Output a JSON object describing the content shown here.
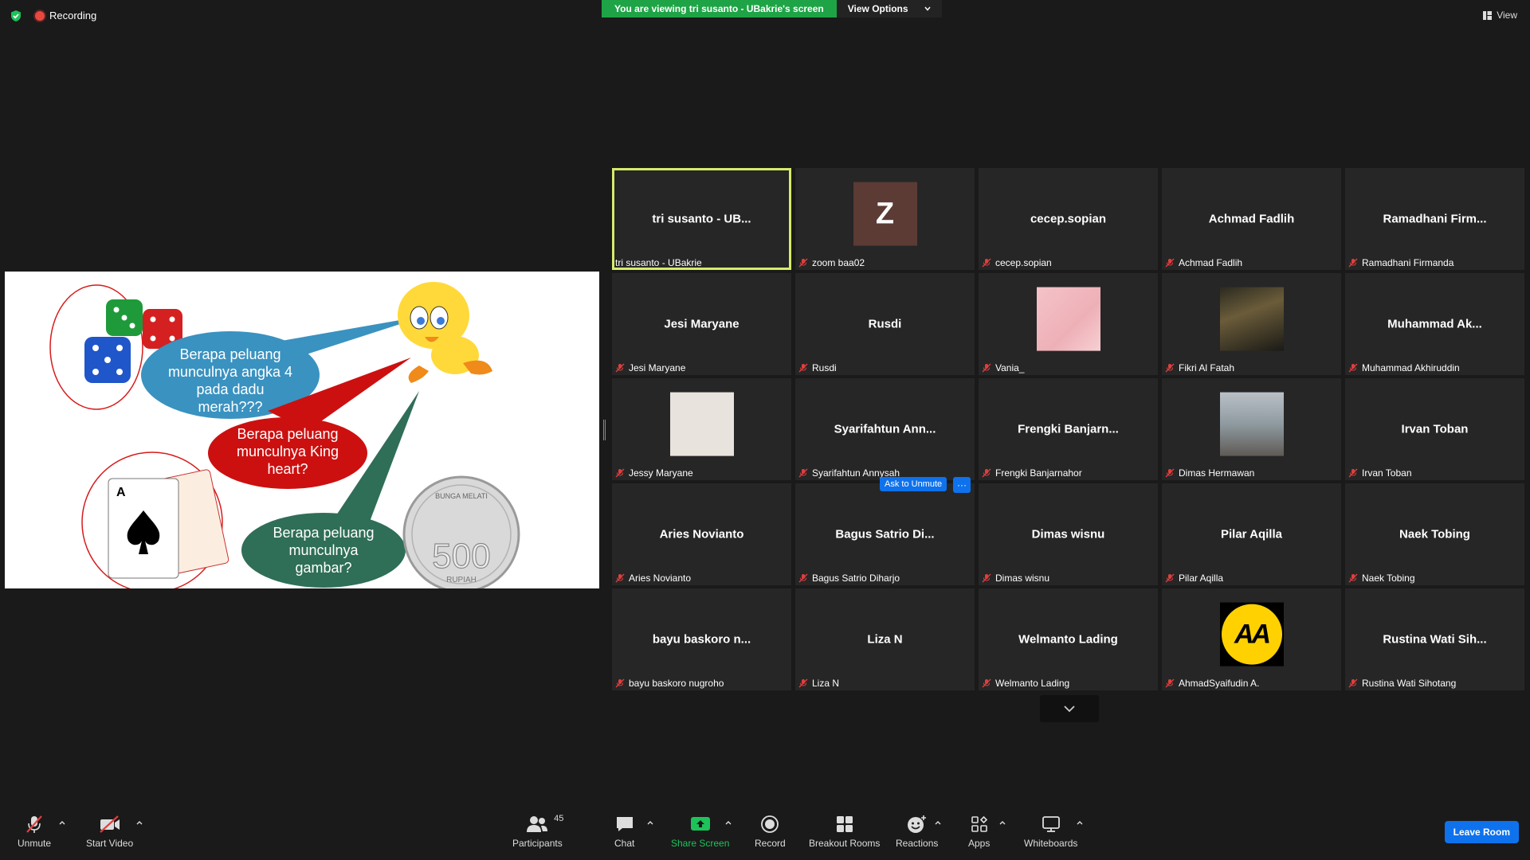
{
  "topbar": {
    "recording": "Recording",
    "banner": "You are viewing tri susanto - UBakrie's screen",
    "view_options": "View Options",
    "view": "View"
  },
  "slide": {
    "q1": [
      "Berapa peluang",
      "munculnya angka 4",
      "pada dadu",
      "merah???"
    ],
    "q2": [
      "Berapa peluang",
      "munculnya  King",
      "heart?"
    ],
    "q3": [
      "Berapa peluang",
      "munculnya",
      "gambar?"
    ],
    "coin_value": "500",
    "coin_top": "BUNGA MELATI",
    "coin_bottom": "RUPIAH",
    "card_letter": "A"
  },
  "tiles": [
    {
      "name": "tri susanto - UB...",
      "label": "tri susanto - UBakrie",
      "muted": false,
      "active": true
    },
    {
      "name": "",
      "label": "zoom baa02",
      "muted": true,
      "avatar": "Z"
    },
    {
      "name": "cecep.sopian",
      "label": "cecep.sopian",
      "muted": true
    },
    {
      "name": "Achmad Fadlih",
      "label": "Achmad Fadlih",
      "muted": true
    },
    {
      "name": "Ramadhani  Firm...",
      "label": "Ramadhani Firmanda",
      "muted": true
    },
    {
      "name": "Jesi Maryane",
      "label": "Jesi Maryane",
      "muted": true
    },
    {
      "name": "Rusdi",
      "label": "Rusdi",
      "muted": true
    },
    {
      "name": "",
      "label": "Vania_",
      "muted": true,
      "avatar": "pink"
    },
    {
      "name": "",
      "label": "Fikri Al Fatah",
      "muted": true,
      "avatar": "photo1"
    },
    {
      "name": "Muhammad  Ak...",
      "label": "Muhammad Akhiruddin",
      "muted": true
    },
    {
      "name": "",
      "label": "Jessy Maryane",
      "muted": true,
      "avatar": "hijab"
    },
    {
      "name": "Syarifahtun  Ann...",
      "label": "Syarifahtun Annysah",
      "muted": true
    },
    {
      "name": "Frengki  Banjarn...",
      "label": "Frengki Banjarnahor",
      "muted": true
    },
    {
      "name": "",
      "label": "Dimas Hermawan",
      "muted": true,
      "avatar": "forest"
    },
    {
      "name": "Irvan Toban",
      "label": "Irvan Toban",
      "muted": true
    },
    {
      "name": "Aries Novianto",
      "label": "Aries Novianto",
      "muted": true
    },
    {
      "name": "Bagus  Satrio  Di...",
      "label": "Bagus Satrio Diharjo",
      "muted": true,
      "ask_unmute": "Ask to Unmute",
      "more": "···"
    },
    {
      "name": "Dimas wisnu",
      "label": "Dimas wisnu",
      "muted": true
    },
    {
      "name": "Pilar Aqilla",
      "label": "Pilar Aqilla",
      "muted": true
    },
    {
      "name": "Naek Tobing",
      "label": "Naek Tobing",
      "muted": true
    },
    {
      "name": "bayu  baskoro  n...",
      "label": "bayu baskoro nugroho",
      "muted": true
    },
    {
      "name": "Liza N",
      "label": "Liza N",
      "muted": true
    },
    {
      "name": "Welmanto Lading",
      "label": "Welmanto Lading",
      "muted": true
    },
    {
      "name": "",
      "label": "AhmadSyaifudin A.",
      "muted": true,
      "avatar": "aa",
      "avatar_text": "AA"
    },
    {
      "name": "Rustina  Wati  Sih...",
      "label": "Rustina Wati Sihotang",
      "muted": true
    }
  ],
  "toolbar": {
    "unmute": "Unmute",
    "start_video": "Start Video",
    "participants": "Participants",
    "participants_count": "45",
    "chat": "Chat",
    "share_screen": "Share Screen",
    "record": "Record",
    "breakout_rooms": "Breakout Rooms",
    "reactions": "Reactions",
    "apps": "Apps",
    "whiteboards": "Whiteboards",
    "leave_room": "Leave Room"
  },
  "colors": {
    "accent_blue": "#0e72ed",
    "banner_green": "#1ea446",
    "active_speaker": "#d8ea6b",
    "mute_red": "#e03e3e"
  }
}
